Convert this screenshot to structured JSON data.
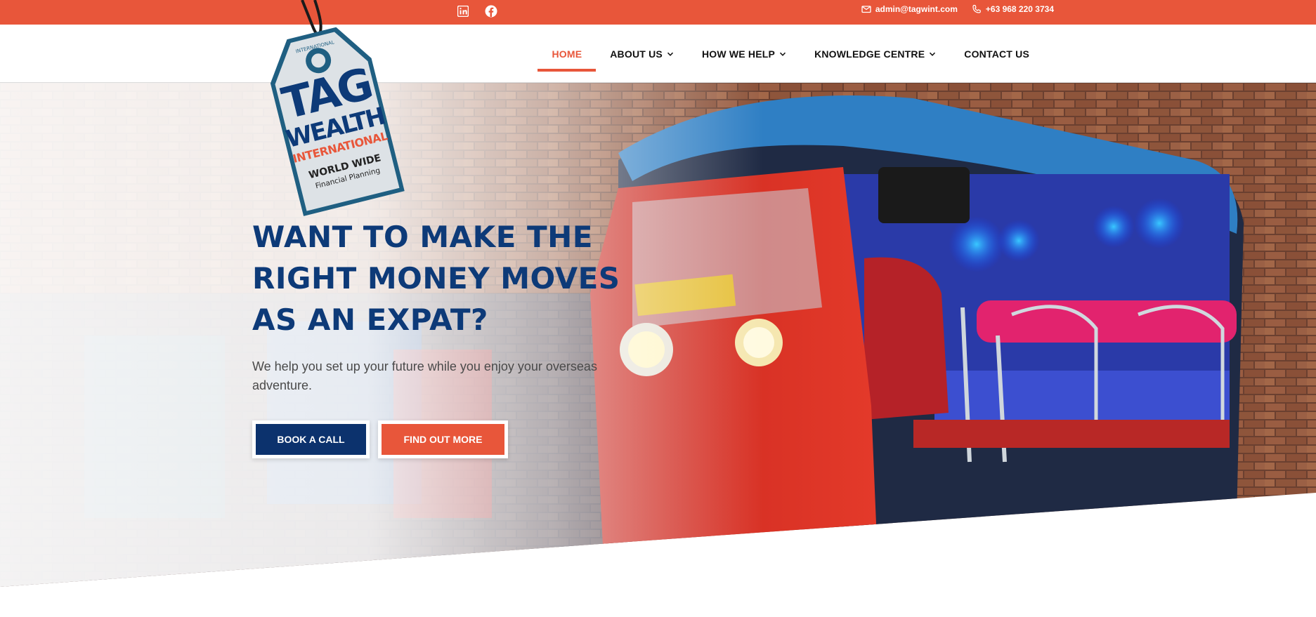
{
  "topbar": {
    "social": [
      {
        "icon": "linkedin-icon"
      },
      {
        "icon": "facebook-icon"
      }
    ],
    "email": "admin@tagwint.com",
    "phone": "+63 968 220 3734"
  },
  "logo": {
    "line1": "TAG",
    "line2": "WEALTH",
    "line3": "INTERNATIONAL",
    "line4": "WORLD WIDE",
    "line5": "Financial Planning",
    "top_text": "INTERNATIONAL"
  },
  "nav": {
    "items": [
      {
        "label": "HOME",
        "active": true,
        "dropdown": false
      },
      {
        "label": "ABOUT US",
        "active": false,
        "dropdown": true
      },
      {
        "label": "HOW WE HELP",
        "active": false,
        "dropdown": true
      },
      {
        "label": "KNOWLEDGE CENTRE",
        "active": false,
        "dropdown": true
      },
      {
        "label": "CONTACT US",
        "active": false,
        "dropdown": false
      }
    ]
  },
  "hero": {
    "title_line1": "WANT TO MAKE THE",
    "title_line2": "RIGHT MONEY MOVES",
    "title_line3": "AS AN EXPAT?",
    "subtitle": "We help you set up your future while you enjoy your overseas adventure.",
    "primary_button": "BOOK A CALL",
    "secondary_button": "FIND OUT MORE"
  },
  "colors": {
    "brand_orange": "#e8563a",
    "brand_navy": "#0c326d",
    "heading_blue": "#0d3a78"
  }
}
